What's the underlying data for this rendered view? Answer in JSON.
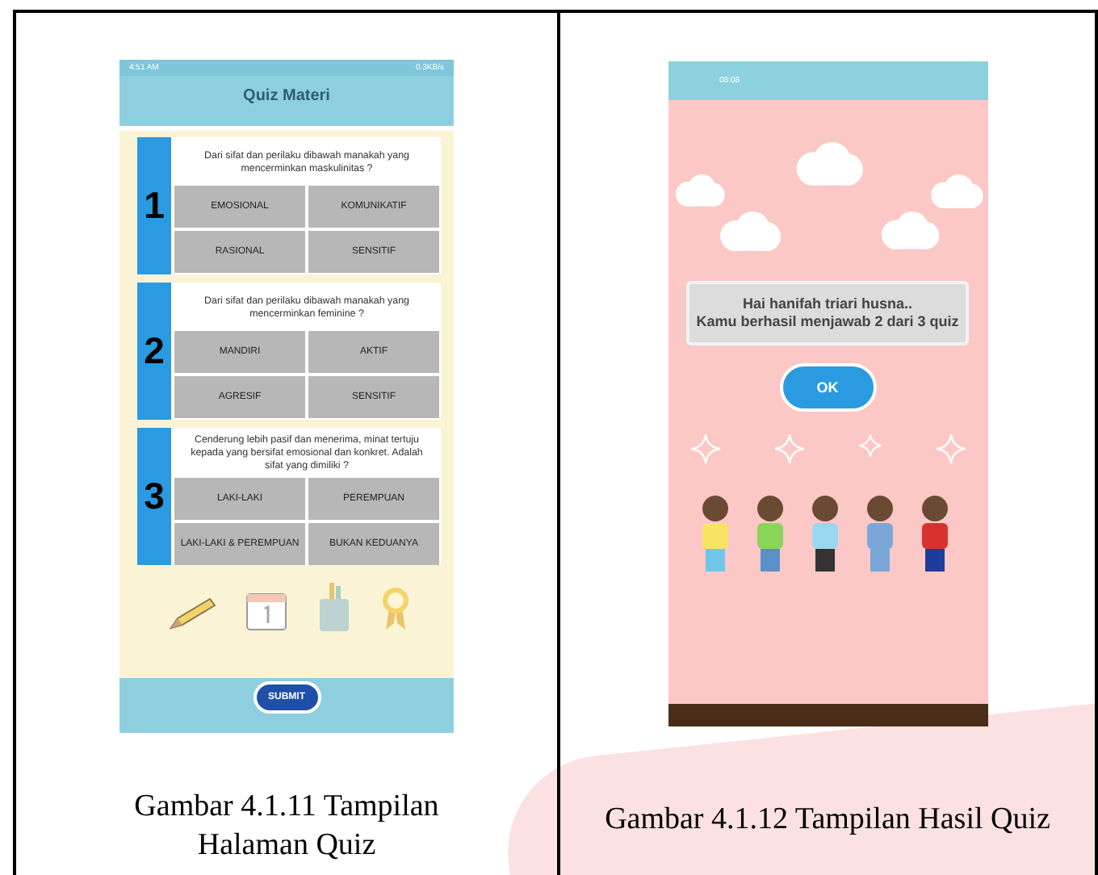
{
  "figures": [
    {
      "kind": "quiz",
      "status_bar": {
        "time": "4:51 AM",
        "speed": "0.3KB/s"
      },
      "title": "Quiz Materi",
      "questions": [
        {
          "number": "1",
          "text": "Dari sifat dan perilaku dibawah manakah yang mencerminkan maskulinitas ?",
          "options": [
            "EMOSIONAL",
            "KOMUNIKATIF",
            "RASIONAL",
            "SENSITIF"
          ]
        },
        {
          "number": "2",
          "text": "Dari sifat dan perilaku dibawah manakah yang mencerminkan feminine ?",
          "options": [
            "MANDIRI",
            "AKTIF",
            "AGRESIF",
            "SENSITIF"
          ]
        },
        {
          "number": "3",
          "text": "Cenderung lebih pasif dan menerima, minat tertuju kepada yang bersifat emosional dan konkret. Adalah sifat yang dimiliki ?",
          "options": [
            "LAKI-LAKI",
            "PEREMPUAN",
            "LAKI-LAKI & PEREMPUAN",
            "BUKAN KEDUANYA"
          ]
        }
      ],
      "submit": "SUBMIT",
      "caption": "Gambar 4.1.11 Tampilan Halaman Quiz"
    },
    {
      "kind": "result",
      "status_bar": {
        "time": "08:08"
      },
      "message": "Hai hanifah triari husna..\nKamu berhasil menjawab  2 dari 3 quiz",
      "button": "OK",
      "caption": "Gambar 4.1.12 Tampilan Hasil Quiz"
    }
  ]
}
